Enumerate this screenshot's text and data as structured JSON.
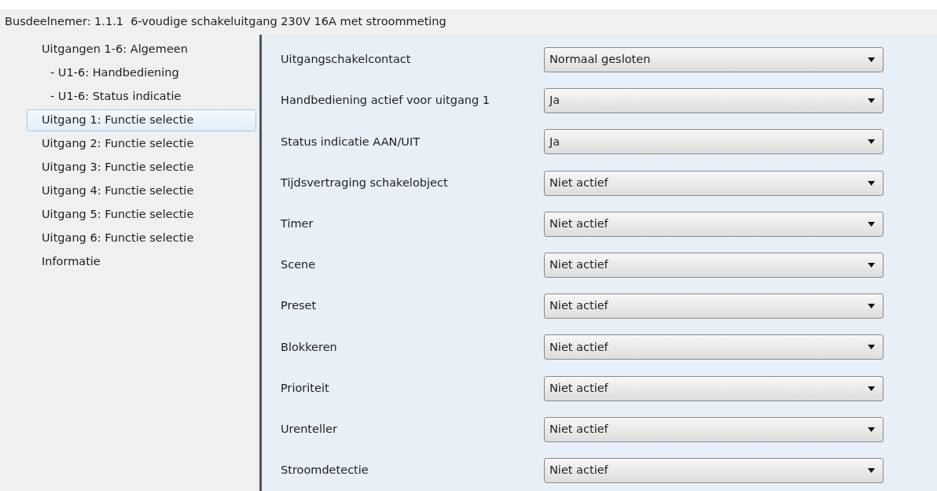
{
  "header": {
    "title": "Busdeelnemer: 1.1.1  6-voudige schakeluitgang 230V 16A met stroommeting"
  },
  "sidebar": {
    "items": [
      {
        "label": "Uitgangen 1-6: Algemeen",
        "selected": false,
        "children": [
          {
            "label": "- U1-6: Handbediening",
            "selected": false
          },
          {
            "label": "- U1-6: Status indicatie",
            "selected": false
          }
        ]
      },
      {
        "label": "Uitgang 1: Functie selectie",
        "selected": true
      },
      {
        "label": "Uitgang 2: Functie selectie",
        "selected": false
      },
      {
        "label": "Uitgang 3: Functie selectie",
        "selected": false
      },
      {
        "label": "Uitgang 4: Functie selectie",
        "selected": false
      },
      {
        "label": "Uitgang 5: Functie selectie",
        "selected": false
      },
      {
        "label": "Uitgang 6: Functie selectie",
        "selected": false
      },
      {
        "label": "Informatie",
        "selected": false
      }
    ]
  },
  "parameters": [
    {
      "label": "Uitgangschakelcontact",
      "value": "Normaal gesloten"
    },
    {
      "label": "Handbediening actief voor uitgang 1",
      "value": "Ja"
    },
    {
      "label": "Status indicatie AAN/UIT",
      "value": "Ja"
    },
    {
      "label": "Tijdsvertraging schakelobject",
      "value": "Niet actief"
    },
    {
      "label": "Timer",
      "value": "Niet actief"
    },
    {
      "label": "Scene",
      "value": "Niet actief"
    },
    {
      "label": "Preset",
      "value": "Niet actief"
    },
    {
      "label": "Blokkeren",
      "value": "Niet actief"
    },
    {
      "label": "Prioriteit",
      "value": "Niet actief"
    },
    {
      "label": "Urenteller",
      "value": "Niet actief"
    },
    {
      "label": "Stroomdetectie",
      "value": "Niet actief"
    }
  ]
}
